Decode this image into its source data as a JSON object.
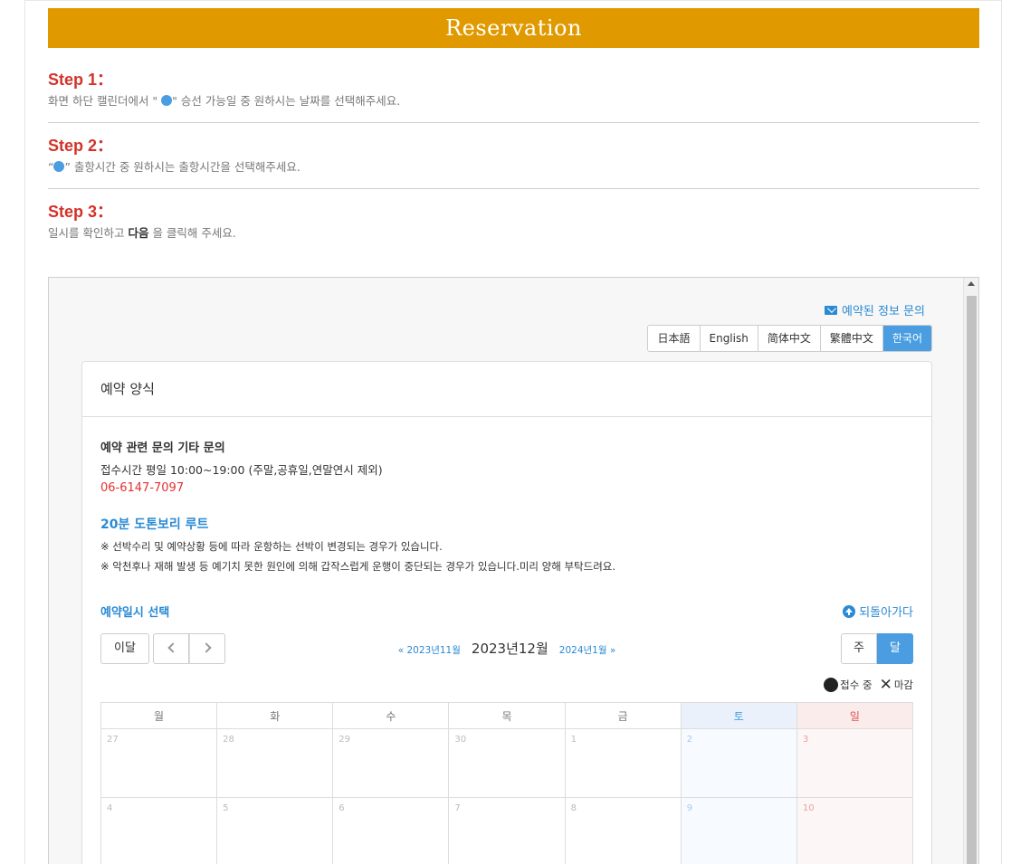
{
  "banner": {
    "title": "Reservation"
  },
  "steps": [
    {
      "title": "Step 1：",
      "desc_before": "화면 하단 캘린더에서 \" ",
      "desc_after": "\" 승선 가능일 중 원하시는 날짜를 선택해주세요."
    },
    {
      "title": "Step 2：",
      "desc_before": "“",
      "desc_after": "” 출항시간 중 원하시는 출항시간을 선택해주세요."
    },
    {
      "title": "Step 3：",
      "desc_before": "일시를 확인하고 ",
      "desc_bold": "다음",
      "desc_after": " 을 클릭해 주세요."
    }
  ],
  "widget": {
    "inquiry_link": "예약된 정보 문의",
    "languages": [
      {
        "label": "日本語",
        "active": false
      },
      {
        "label": "English",
        "active": false
      },
      {
        "label": "简体中文",
        "active": false
      },
      {
        "label": "繁體中文",
        "active": false
      },
      {
        "label": "한국어",
        "active": true
      }
    ],
    "panel_title": "예약 양식",
    "contact": {
      "title": "예약 관련 문의 기타 문의",
      "hours": "접수시간 평일 10:00~19:00 (주말,공휴일,연말연시 제외)",
      "phone": "06-6147-7097"
    },
    "route_title": "20분 도톤보리 루트",
    "notes": [
      "※ 선박수리 및 예약상황 등에 따라 운항하는 선박이 변경되는 경우가 있습니다.",
      "※ 악천후나 재해 발생 등 예기치 못한 원인에 의해 갑작스럽게 운행이 중단되는 경우가 있습니다.미리 양해 부탁드려요."
    ],
    "select_title": "예약일시 선택",
    "back_link": "되돌아가다",
    "calendar": {
      "today_btn": "이달",
      "prev_month": "« 2023년11월",
      "current_month": "2023년12월",
      "next_month": "2024년1월 »",
      "week_btn": "주",
      "month_btn": "달",
      "legend_open": "접수 중",
      "legend_closed": "마감",
      "weekdays": [
        "월",
        "화",
        "수",
        "목",
        "금",
        "토",
        "일"
      ],
      "weeks": [
        [
          "27",
          "28",
          "29",
          "30",
          "1",
          "2",
          "3"
        ],
        [
          "4",
          "5",
          "6",
          "7",
          "8",
          "9",
          "10"
        ]
      ]
    }
  },
  "colors": {
    "banner": "#e09a00",
    "step_title": "#d2332a",
    "accent": "#4a9de0",
    "link": "#2a8ad4",
    "phone": "#e53030"
  }
}
